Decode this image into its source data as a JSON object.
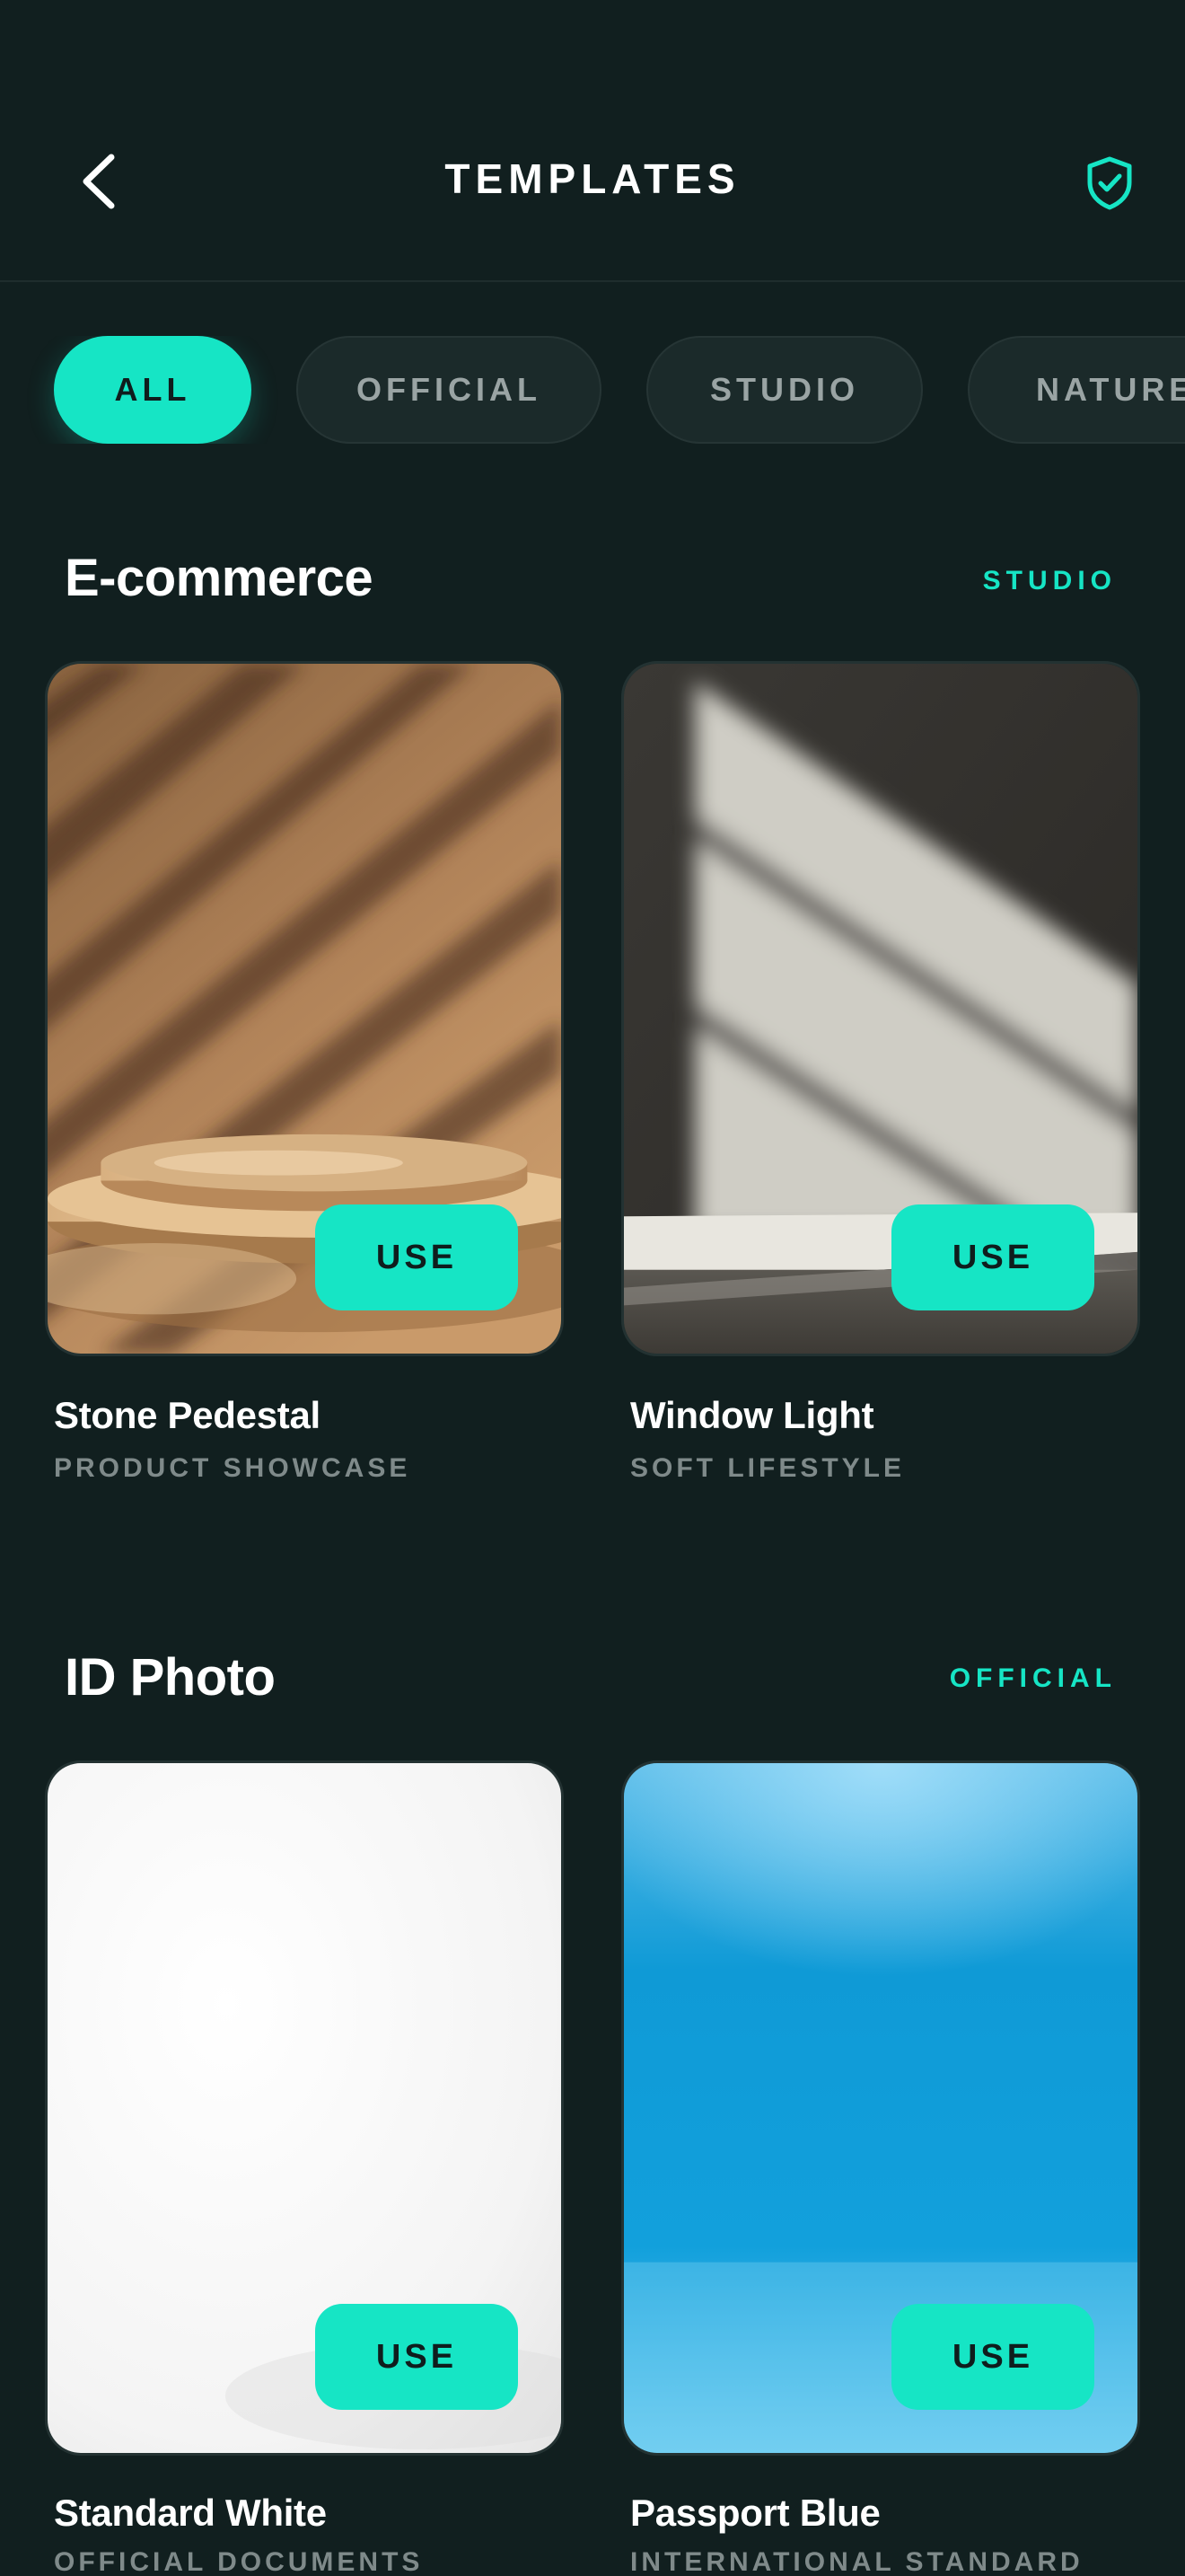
{
  "header": {
    "title": "TEMPLATES",
    "back_icon": "chevron-left-icon",
    "shield_icon": "shield-check-icon"
  },
  "filters": [
    {
      "label": "ALL",
      "active": true
    },
    {
      "label": "OFFICIAL",
      "active": false
    },
    {
      "label": "STUDIO",
      "active": false
    },
    {
      "label": "NATURE",
      "active": false
    }
  ],
  "sections": [
    {
      "title": "E-commerce",
      "tag": "STUDIO",
      "cards": [
        {
          "name": "Stone Pedestal",
          "subtitle": "PRODUCT SHOWCASE",
          "button": "USE"
        },
        {
          "name": "Window Light",
          "subtitle": "SOFT LIFESTYLE",
          "button": "USE"
        }
      ]
    },
    {
      "title": "ID Photo",
      "tag": "OFFICIAL",
      "cards": [
        {
          "name": "Standard White",
          "subtitle": "OFFICIAL DOCUMENTS",
          "button": "USE"
        },
        {
          "name": "Passport Blue",
          "subtitle": "INTERNATIONAL STANDARD",
          "button": "USE"
        }
      ]
    }
  ],
  "colors": {
    "background": "#111f1f",
    "accent": "#16e5c5",
    "chip_inactive": "#1b2a2a",
    "muted_text": "#7f8a8a"
  }
}
